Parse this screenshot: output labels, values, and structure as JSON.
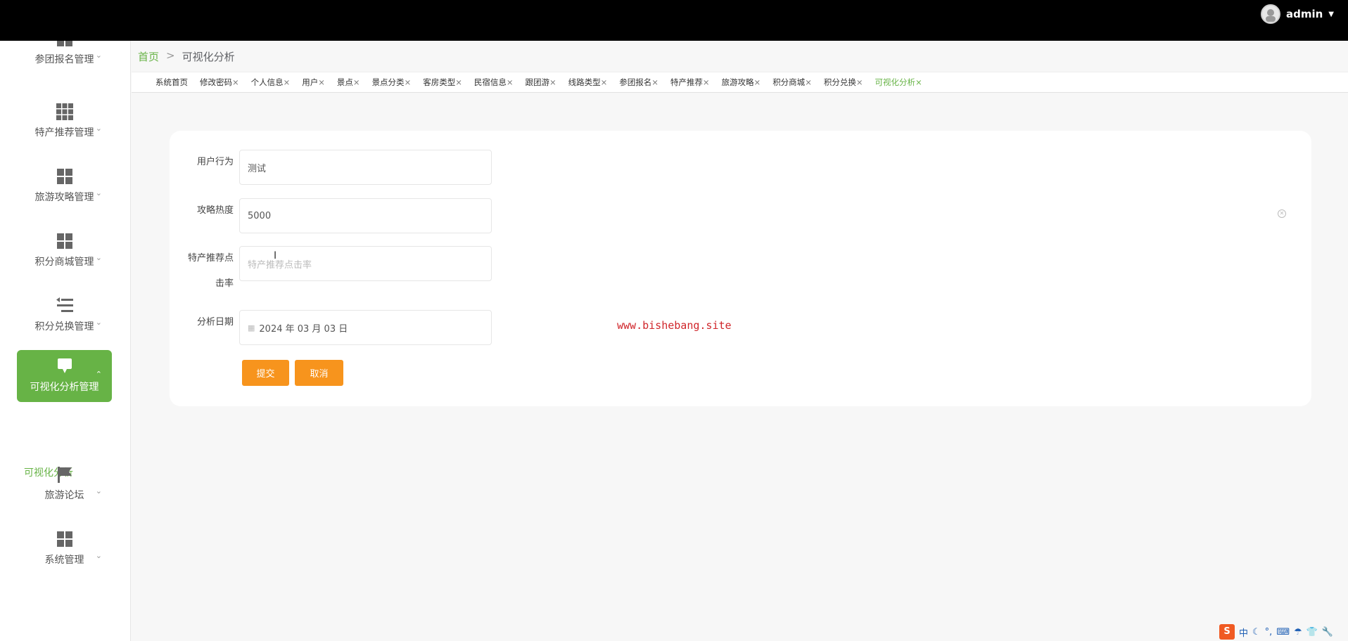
{
  "header": {
    "username": "admin",
    "dropdown_glyph": "▼"
  },
  "sidebar": {
    "items": [
      {
        "label": "参团报名管理",
        "icon": "grid-icon"
      },
      {
        "label": "特产推荐管理",
        "icon": "grid9-icon"
      },
      {
        "label": "旅游攻略管理",
        "icon": "grid-icon"
      },
      {
        "label": "积分商城管理",
        "icon": "grid-icon"
      },
      {
        "label": "积分兑换管理",
        "icon": "list-icon"
      },
      {
        "label": "可视化分析管理",
        "icon": "chat-icon",
        "active": true
      },
      {
        "label": "旅游论坛",
        "icon": "flag-icon"
      },
      {
        "label": "系统管理",
        "icon": "grid-icon"
      }
    ],
    "submenu": "可视化分析",
    "active_color": "#67b346"
  },
  "breadcrumb": {
    "home": "首页",
    "sep": ">",
    "current": "可视化分析"
  },
  "tabs": [
    {
      "label": "系统首页",
      "closable": false
    },
    {
      "label": "修改密码",
      "closable": true
    },
    {
      "label": "个人信息",
      "closable": true
    },
    {
      "label": "用户",
      "closable": true
    },
    {
      "label": "景点",
      "closable": true
    },
    {
      "label": "景点分类",
      "closable": true
    },
    {
      "label": "客房类型",
      "closable": true
    },
    {
      "label": "民宿信息",
      "closable": true
    },
    {
      "label": "跟团游",
      "closable": true
    },
    {
      "label": "线路类型",
      "closable": true
    },
    {
      "label": "参团报名",
      "closable": true
    },
    {
      "label": "特产推荐",
      "closable": true
    },
    {
      "label": "旅游攻略",
      "closable": true
    },
    {
      "label": "积分商城",
      "closable": true
    },
    {
      "label": "积分兑换",
      "closable": true
    },
    {
      "label": "可视化分析",
      "closable": true,
      "active": true
    }
  ],
  "tab_close_glyph": "×",
  "form": {
    "user_behavior": {
      "label": "用户行为",
      "value": "测试"
    },
    "strategy_heat": {
      "label": "攻略热度",
      "value": "5000"
    },
    "specialty_click_rate": {
      "label_line1": "特产推荐点",
      "label_line2": "击率",
      "placeholder": "特产推荐点击率"
    },
    "analysis_date": {
      "label": "分析日期",
      "value": "2024 年 03 月 03 日"
    },
    "submit_label": "提交",
    "cancel_label": "取消",
    "button_color": "#f7941d"
  },
  "watermark": "www.bishebang.site",
  "ime": {
    "logo": "S",
    "lang": "中"
  }
}
